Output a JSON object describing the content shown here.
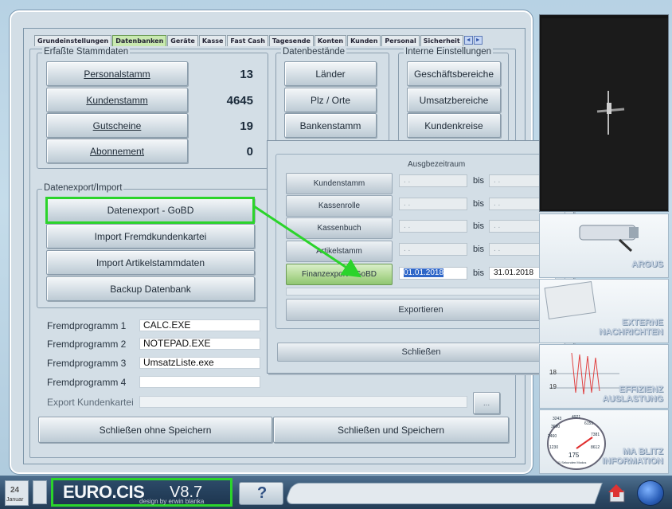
{
  "tabs": [
    "Grundeinstellungen",
    "Datenbanken",
    "Geräte",
    "Kasse",
    "Fast Cash",
    "Tagesende",
    "Konten",
    "Kunden",
    "Personal",
    "Sicherheit"
  ],
  "tab_arrows": {
    "left": "◄",
    "right": "►"
  },
  "stammdaten": {
    "title": "Erfaßte Stammdaten",
    "rows": [
      {
        "label": "Personalstamm",
        "count": "13"
      },
      {
        "label": "Kundenstamm",
        "count": "4645"
      },
      {
        "label": "Gutscheine",
        "count": "19"
      },
      {
        "label": "Abonnement",
        "count": "0"
      }
    ]
  },
  "bestaende": {
    "title": "Datenbestände",
    "buttons": [
      "Länder",
      "Plz / Orte",
      "Bankenstamm"
    ]
  },
  "interne": {
    "title": "Interne Einstellungen",
    "buttons": [
      "Geschäftsbereiche",
      "Umsatzbereiche",
      "Kundenkreise"
    ]
  },
  "export": {
    "title": "Datenexport/Import",
    "buttons": [
      "Datenexport - GoBD",
      "Import Fremdkundenkartei",
      "Import Artikelstammdaten",
      "Backup Datenbank"
    ]
  },
  "fremd": [
    {
      "label": "Fremdprogramm 1",
      "value": "CALC.EXE"
    },
    {
      "label": "Fremdprogramm 2",
      "value": "NOTEPAD.EXE"
    },
    {
      "label": "Fremdprogramm 3",
      "value": "UmsatzListe.exe"
    },
    {
      "label": "Fremdprogramm 4",
      "value": ""
    }
  ],
  "export_kundenkartei": {
    "label": "Export Kundenkartei",
    "value": "",
    "browse": "..."
  },
  "footer_buttons": {
    "close_no_save": "Schließen ohne Speichern",
    "close_save": "Schließen und Speichern"
  },
  "dialog": {
    "header": "Ausgbezeitraum",
    "bis": "bis",
    "rows": [
      {
        "label": "Kundenstamm",
        "from": " . .",
        "to": " . .",
        "active": false
      },
      {
        "label": "Kassenrolle",
        "from": " . .",
        "to": " . .",
        "active": false
      },
      {
        "label": "Kassenbuch",
        "from": " . .",
        "to": " . .",
        "active": false
      },
      {
        "label": "Artikelstamm",
        "from": " . .",
        "to": " . .",
        "active": false
      },
      {
        "label": "Finanzexport - GoBD",
        "from": "01.01.2018",
        "to": "31.01.2018",
        "active": true
      }
    ],
    "export_button": "Exportieren",
    "close_button": "Schließen"
  },
  "right_panel": {
    "argus": "ARGUS",
    "externe": [
      "EXTERNE",
      "NACHRICHTEN"
    ],
    "effizienz": [
      "EFFIZIENZ",
      "AUSLASTUNG"
    ],
    "ma_blitz": [
      "MA BLITZ",
      "INFORMATION"
    ],
    "gauge_numbers": [
      "3243",
      "4921",
      "3690",
      "6151",
      "2460",
      "7381",
      "1230",
      "8612",
      "175"
    ],
    "gauge_caption": "11 Sekunden Modus",
    "chart_numbers": [
      "18",
      "19"
    ]
  },
  "bottom": {
    "logo_main": "EURO.CIS",
    "logo_version": "V8.7",
    "logo_sub": "design by erwin blanka",
    "calendar_day": "24",
    "calendar_month": "Januar"
  },
  "colors": {
    "highlight": "#2bd42b",
    "active_tab": "#c9e9b0"
  }
}
